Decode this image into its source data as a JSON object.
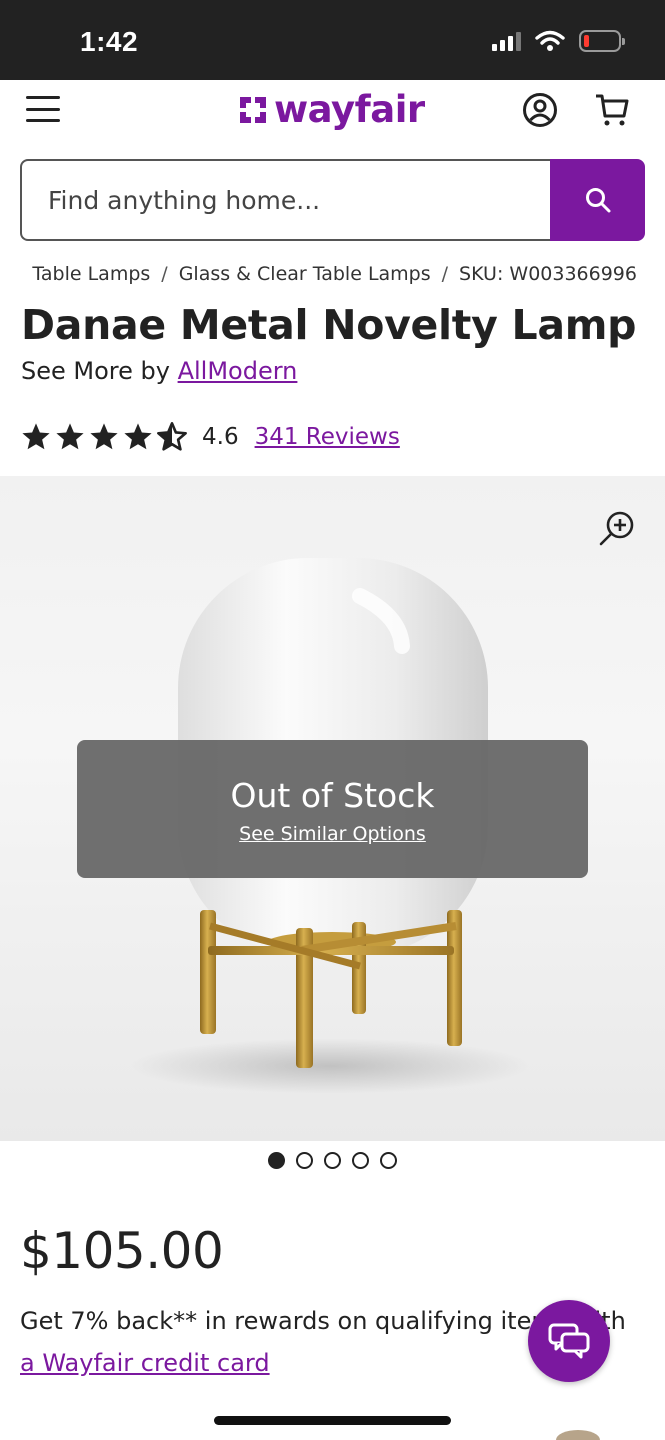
{
  "status_bar": {
    "time": "1:42"
  },
  "header": {
    "logo_text": "wayfair",
    "brand_color": "#7b189f",
    "icons": [
      "menu-icon",
      "account-icon",
      "cart-icon"
    ]
  },
  "search": {
    "placeholder": "Find anything home...",
    "button_icon": "search-icon"
  },
  "breadcrumb": {
    "items": [
      "Table Lamps",
      "Glass & Clear Table Lamps",
      "SKU: W003366996"
    ],
    "separator": "/"
  },
  "product": {
    "title": "Danae Metal Novelty Lamp",
    "see_more_prefix": "See More by ",
    "brand": "AllModern",
    "rating": "4.6",
    "rating_stars": 4.5,
    "reviews_label": "341 Reviews"
  },
  "image": {
    "status_title": "Out of Stock",
    "status_link": "See Similar Options",
    "carousel_total": 5,
    "carousel_active": 1
  },
  "pricing": {
    "price": "$105.00",
    "rewards_text": "Get 7% back** in rewards on qualifying items with",
    "rewards_link": "a Wayfair credit card"
  }
}
